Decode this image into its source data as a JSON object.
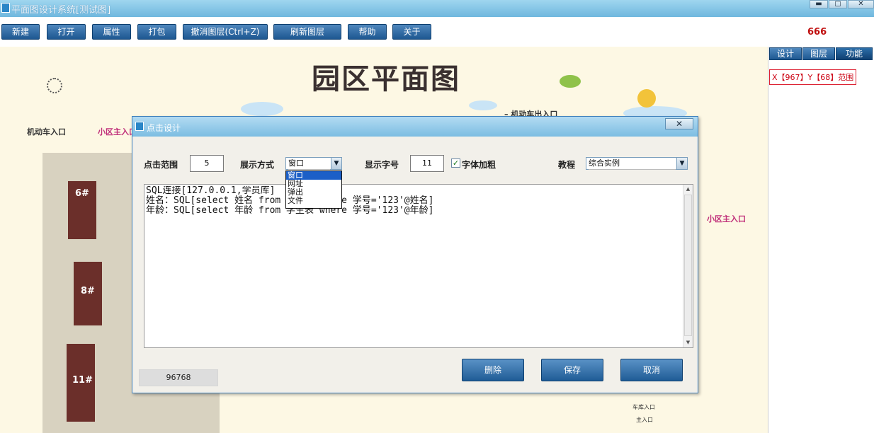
{
  "window": {
    "title": "平面图设计系统[测试图]",
    "min_glyph": "▬",
    "max_glyph": "▢",
    "close_glyph": "✕"
  },
  "toolbar": {
    "new": "新建",
    "open": "打开",
    "properties": "属性",
    "pack": "打包",
    "undo_layer": "撤消图层(Ctrl+Z)",
    "refresh_layer": "刷新图层",
    "help": "帮助",
    "about": "关于",
    "counter": "666"
  },
  "map": {
    "title": "园区平面图",
    "labels": {
      "vehicle_entrance": "机动车入口",
      "residential_entrance_left": "小区主入口",
      "vehicle_exit": "– 机动车出入口",
      "residential_entrance_right": "小区主入口",
      "building_6": "6#",
      "building_8": "8#",
      "building_11": "11#",
      "legend_1": "车库入口",
      "legend_2": "主入口"
    }
  },
  "right_panel": {
    "tabs": [
      "设计",
      "图层",
      "功能"
    ],
    "coord": "X【967】Y【68】范围"
  },
  "dialog": {
    "title": "点击设计",
    "close_glyph": "✕",
    "range_label": "点击范围",
    "range_value": "5",
    "display_label": "展示方式",
    "display_value": "窗口",
    "display_options": [
      "窗口",
      "网址",
      "弹出",
      "文件"
    ],
    "font_size_label": "显示字号",
    "font_size_value": "11",
    "bold_label": "字体加粗",
    "bold_check": "✓",
    "tutorial_label": "教程",
    "tutorial_value": "综合实例",
    "editor_text": "SQL连接[127.0.0.1,学员库]\n姓名：SQL[select 姓名 from 学生表 where 学号='123'@姓名]\n年龄：SQL[select 年龄 from 学生表 where 学号='123'@年龄]",
    "status": "96768",
    "delete": "删除",
    "save": "保存",
    "cancel": "取消",
    "arrow_glyph": "▼",
    "scroll_up": "▲",
    "scroll_down": "▼"
  }
}
